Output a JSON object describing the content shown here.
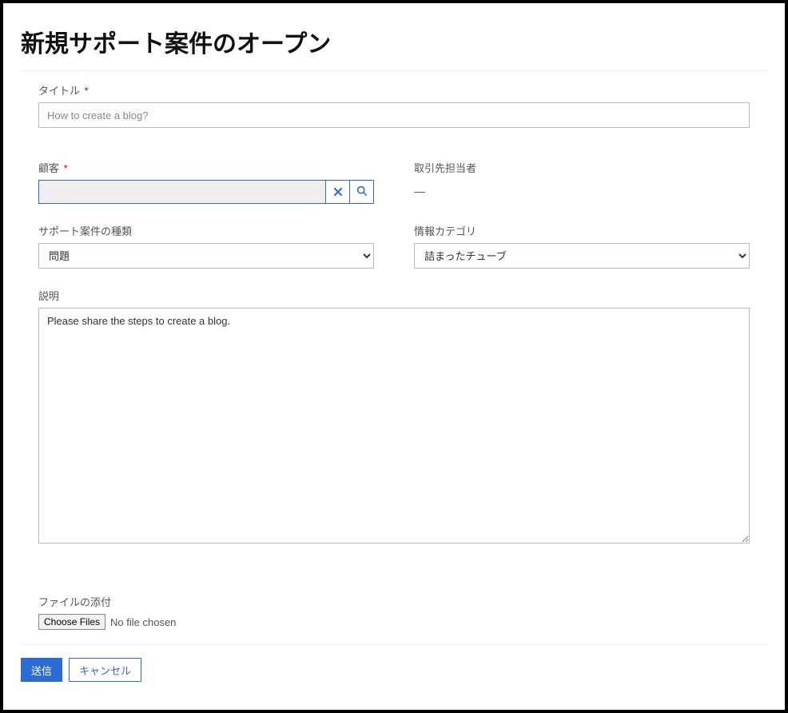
{
  "page": {
    "title": "新規サポート案件のオープン"
  },
  "form": {
    "title_label": "タイトル",
    "title_required": "*",
    "title_value": "How to create a blog?",
    "customer_label": "顧客",
    "customer_required": "*",
    "customer_value": "",
    "contact_label": "取引先担当者",
    "contact_value": "—",
    "case_type_label": "サポート案件の種類",
    "case_type_selected": "問題",
    "info_category_label": "情報カテゴリ",
    "info_category_selected": "詰まったチューブ",
    "description_label": "説明",
    "description_value": "Please share the steps to create a blog.",
    "attach_label": "ファイルの添付",
    "choose_files_label": "Choose Files",
    "no_file_text": "No file chosen"
  },
  "icons": {
    "clear": "✖",
    "search": "search"
  },
  "buttons": {
    "submit": "送信",
    "cancel": "キャンセル"
  }
}
